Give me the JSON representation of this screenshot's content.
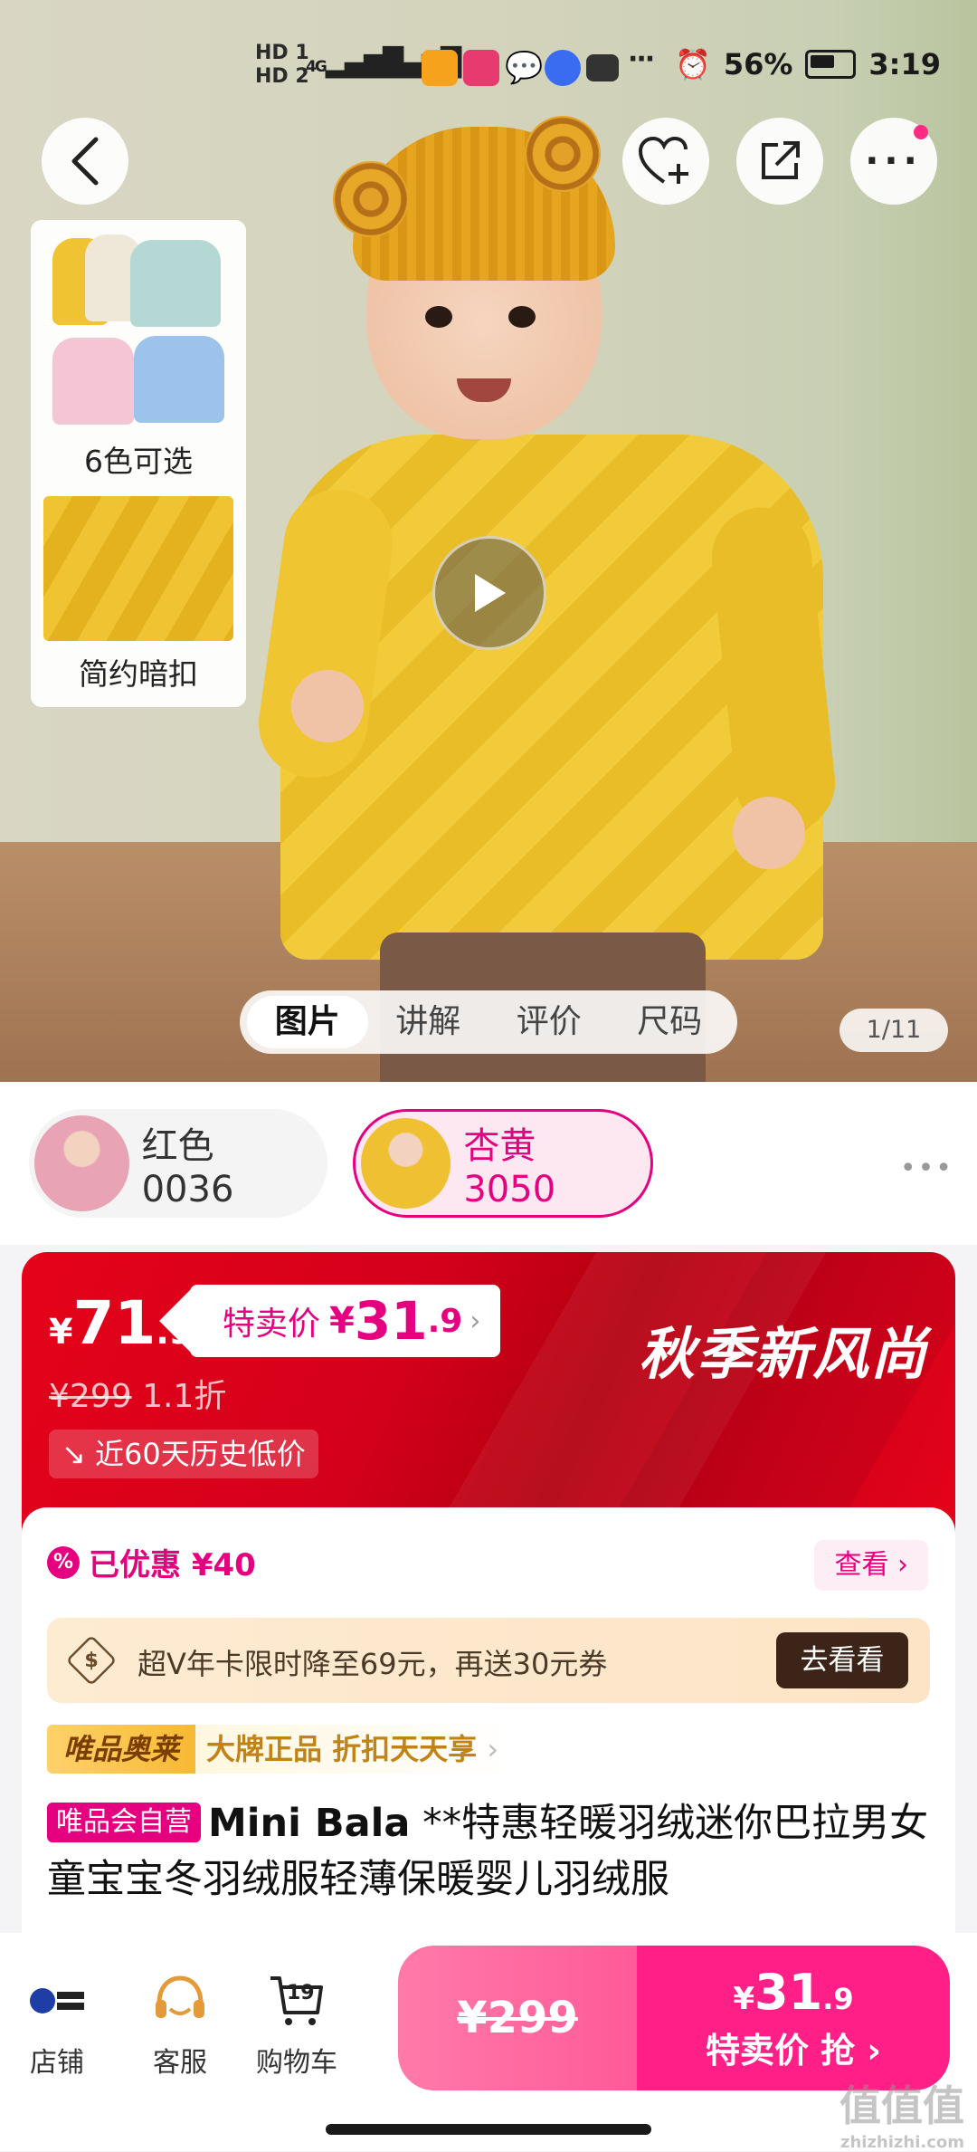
{
  "status_bar": {
    "hd1": "HD 1",
    "hd2": "HD 2",
    "net1": "4G",
    "net2": "4G",
    "battery": "56%",
    "time": "3:19",
    "more": "···"
  },
  "hero": {
    "thumb_card": {
      "label1": "6色可选",
      "label2": "简约暗扣"
    },
    "media_tabs": [
      "图片",
      "讲解",
      "评价",
      "尺码"
    ],
    "active_tab": "图片",
    "page_indicator": "1/11"
  },
  "variants": [
    {
      "name": "红色0036",
      "selected": false
    },
    {
      "name": "杏黄3050",
      "selected": true
    }
  ],
  "price": {
    "orig_yen": "¥",
    "orig_int": "71",
    "orig_dec": ".9",
    "sale_label": "特卖价",
    "sale_yen": "¥",
    "sale_int": "31",
    "sale_dec": ".9",
    "list_price": "¥299",
    "discount": "1.1折",
    "history_badge": "近60天历史低价",
    "season_slogan": "秋季新风尚"
  },
  "info": {
    "discount_text": "已优惠 ¥40",
    "view_label": "查看",
    "vip_text": "超V年卡限时降至69元，再送30元券",
    "vip_button": "去看看",
    "outlet_tag": "唯品奥莱",
    "outlet_desc": "大牌正品 折扣天天享",
    "self_tag": "唯品会自营",
    "brand": "Mini Bala",
    "title": "**特惠轻暖羽绒迷你巴拉男女童宝宝冬羽绒服轻薄保暖婴儿羽绒服"
  },
  "bottom_bar": {
    "store_label": "店铺",
    "service_label": "客服",
    "cart_label": "购物车",
    "cart_count": "19",
    "buy_orig_price": "¥299",
    "buy_sale_yen": "¥",
    "buy_sale_int": "31",
    "buy_sale_dec": ".9",
    "buy_label": "特卖价 抢"
  },
  "watermark": {
    "text": "值值值",
    "sub": "zhizhizhi.com"
  },
  "colors": {
    "accent_pink": "#e5007f",
    "banner_red": "#d4001b",
    "buy_pink": "#ff1f86"
  }
}
